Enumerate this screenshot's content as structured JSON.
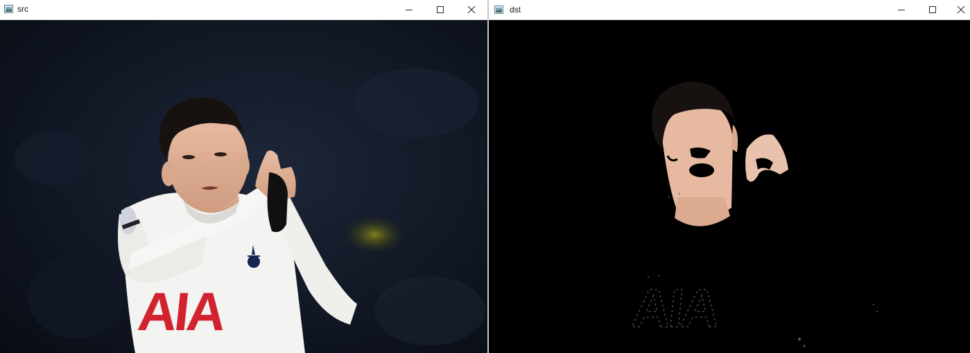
{
  "windows": {
    "src": {
      "title": "src"
    },
    "dst": {
      "title": "dst"
    }
  },
  "controls": {
    "minimize": "minimize",
    "maximize": "maximize",
    "close": "close"
  },
  "jersey": {
    "sponsor": "AIA"
  },
  "colors": {
    "titlebar": "#ffffff",
    "stadium_bg": "#0e1420",
    "jersey_white": "#f3f3f1",
    "sponsor_red": "#d3222f",
    "skin": "#e3b49a",
    "hair": "#17120f",
    "dst_bg": "#000000"
  }
}
